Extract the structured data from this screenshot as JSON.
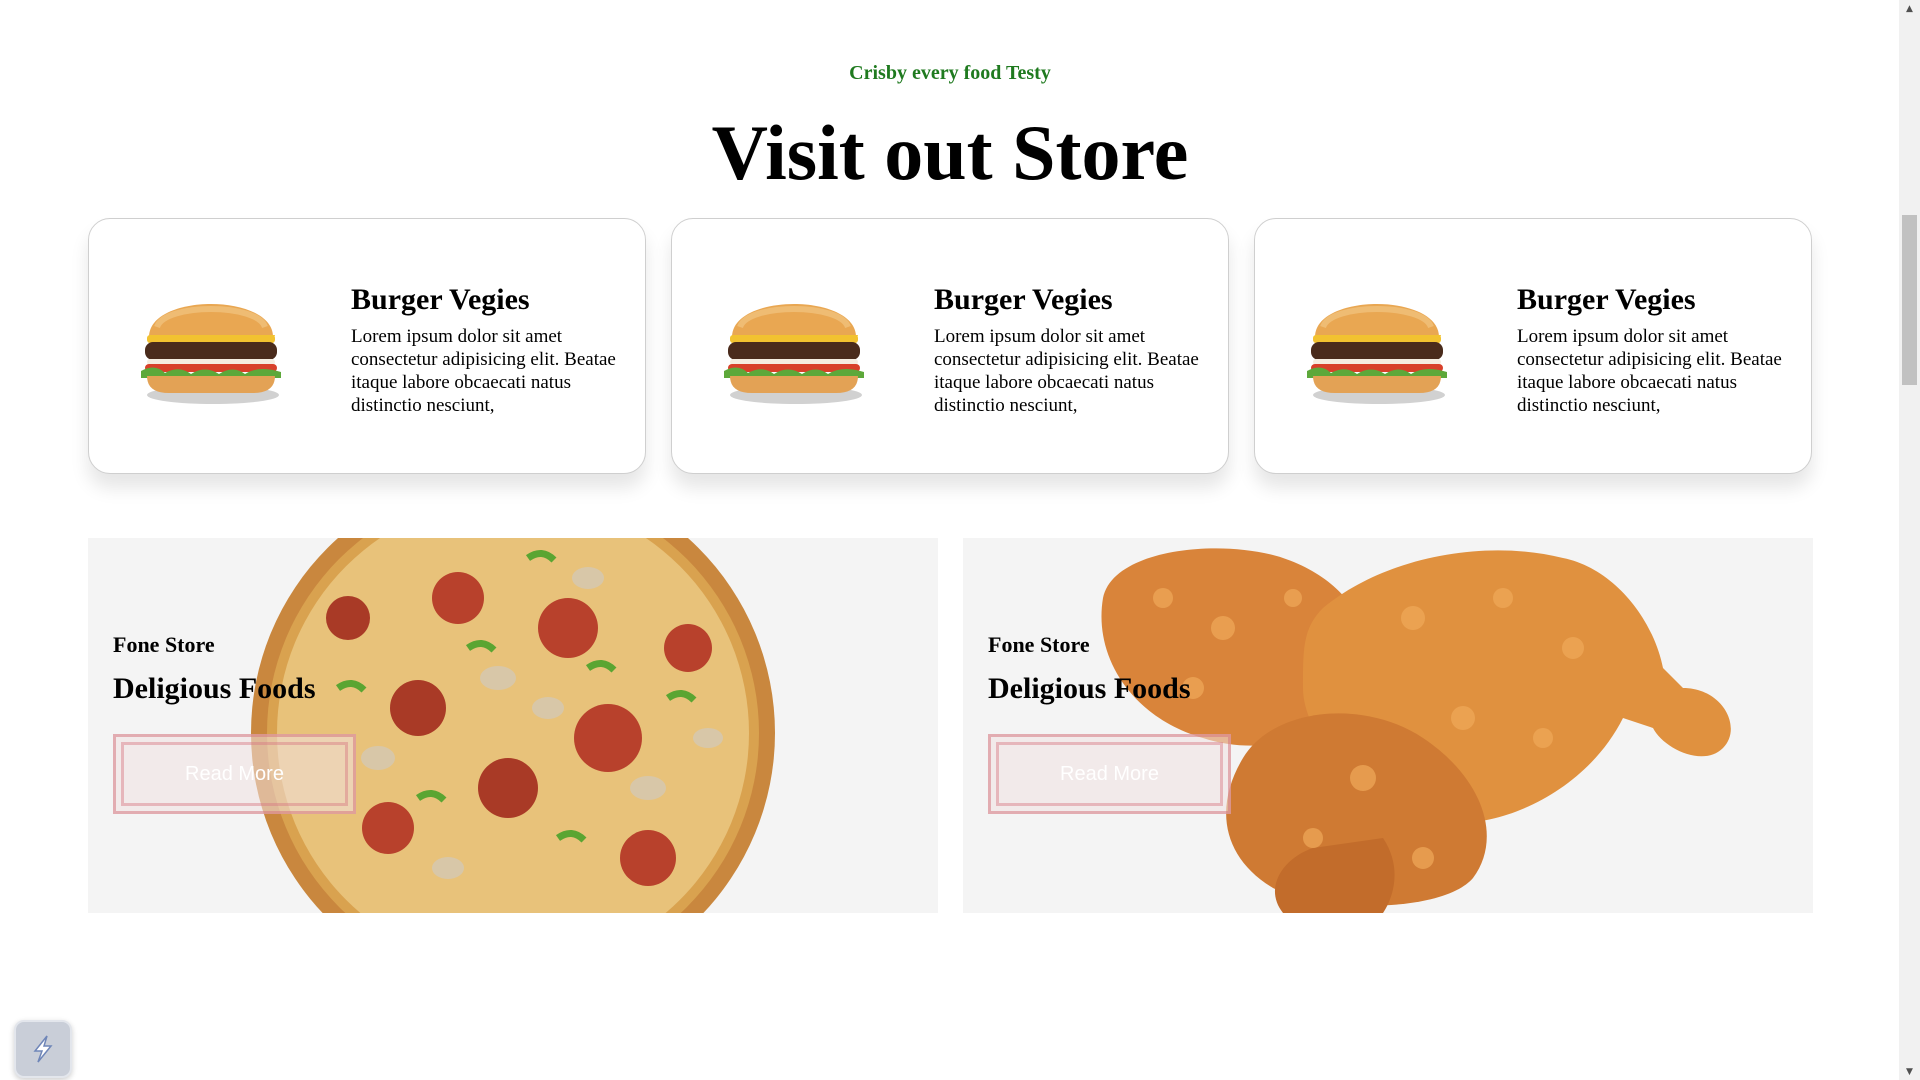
{
  "header": {
    "eyebrow": "Crisby every food Testy",
    "title": "Visit out Store"
  },
  "cards": [
    {
      "title": "Burger Vegies",
      "description": "Lorem ipsum dolor sit amet consectetur adipisicing elit. Beatae itaque labore obcaecati natus distinctio nesciunt,",
      "image": "burger-image"
    },
    {
      "title": "Burger Vegies",
      "description": "Lorem ipsum dolor sit amet consectetur adipisicing elit. Beatae itaque labore obcaecati natus distinctio nesciunt,",
      "image": "burger-image"
    },
    {
      "title": "Burger Vegies",
      "description": "Lorem ipsum dolor sit amet consectetur adipisicing elit. Beatae itaque labore obcaecati natus distinctio nesciunt,",
      "image": "burger-image"
    }
  ],
  "promos": [
    {
      "kicker": "Fone Store",
      "heading": "Deligious Foods",
      "button_label": "Read More",
      "image": "pizza-image"
    },
    {
      "kicker": "Fone Store",
      "heading": "Deligious Foods",
      "button_label": "Read More",
      "image": "fried-chicken-image"
    }
  ],
  "scrollbar": {
    "up_icon": "▲",
    "down_icon": "▼"
  },
  "colors": {
    "accent_green": "#1f7a1f",
    "promo_background": "#f4f4f4",
    "button_border": "#d67882"
  }
}
